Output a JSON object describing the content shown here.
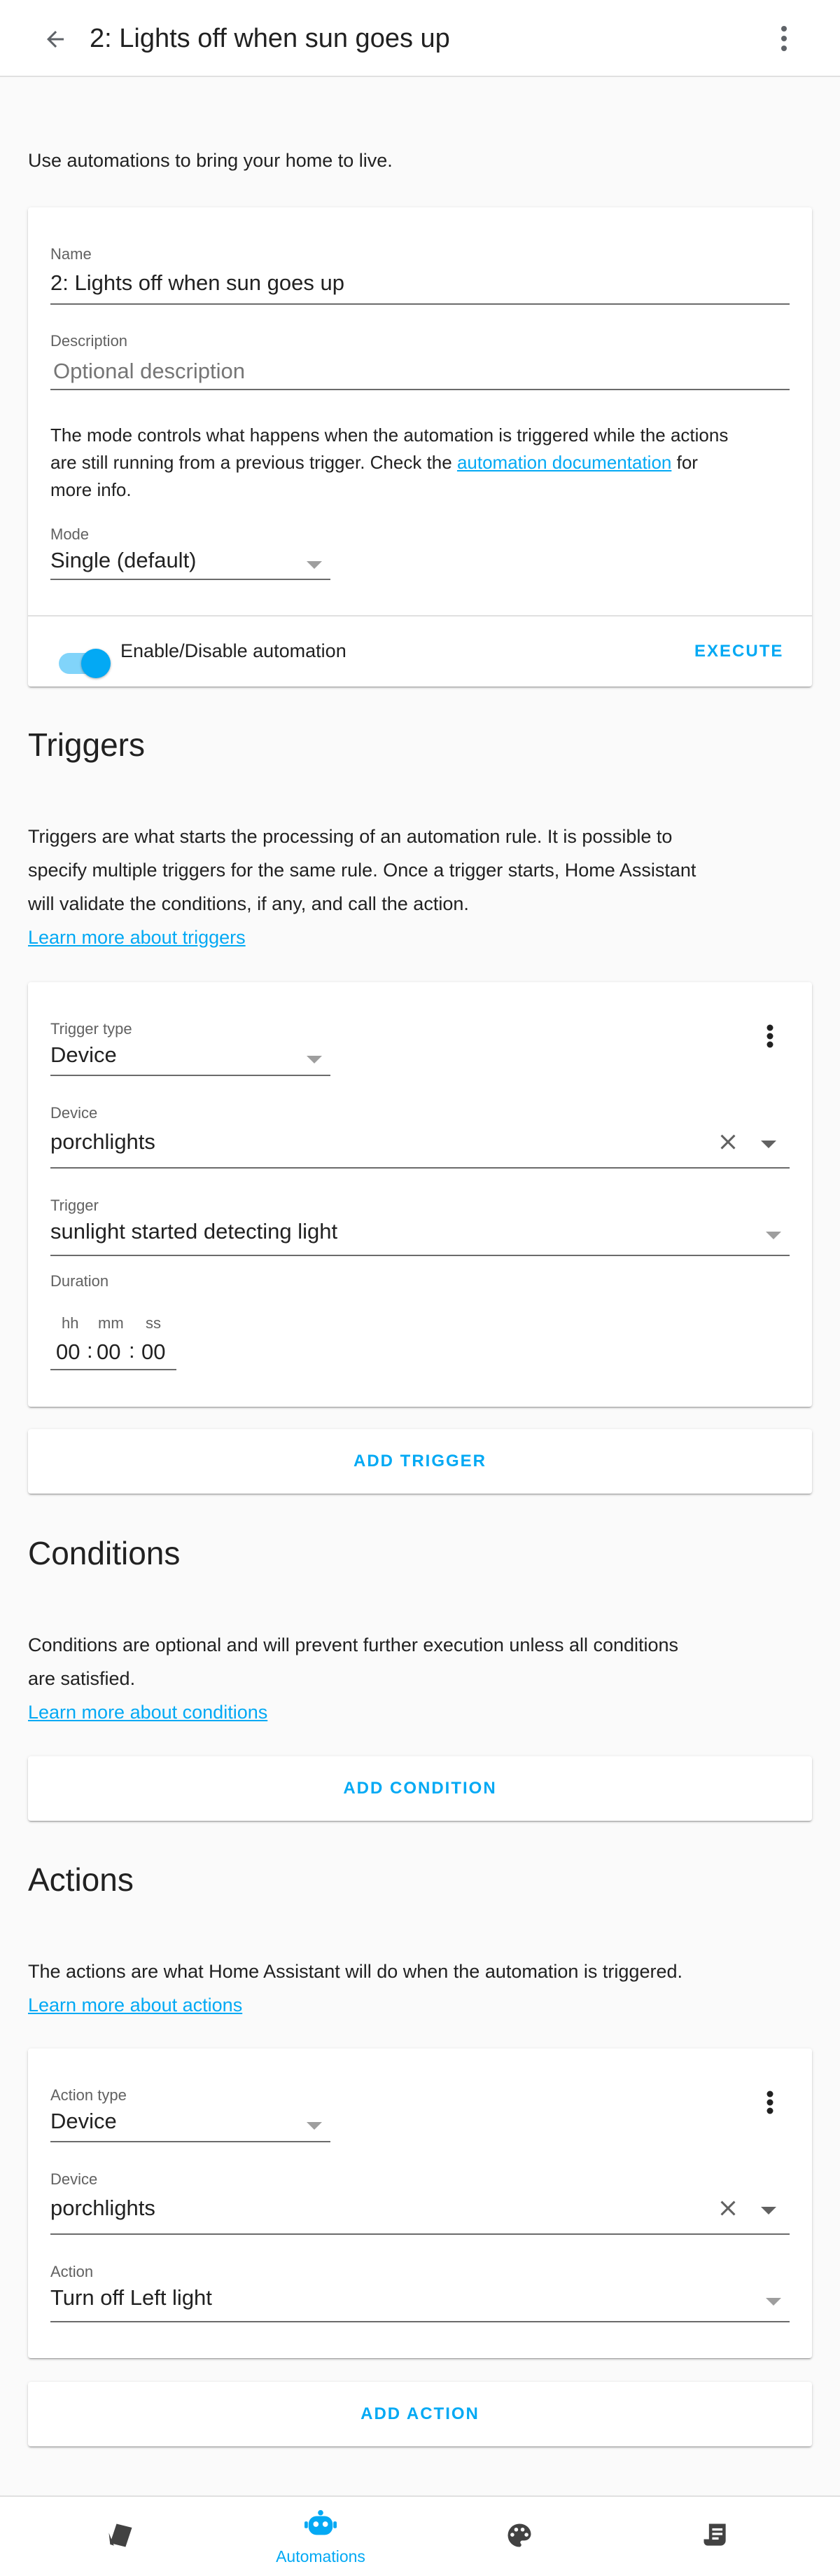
{
  "header": {
    "title": "2: Lights off when sun goes up"
  },
  "intro": "Use automations to bring your home to live.",
  "details": {
    "name_label": "Name",
    "name_value": "2: Lights off when sun goes up",
    "description_label": "Description",
    "description_placeholder": "Optional description",
    "mode_text_1": "The mode controls what happens when the automation is triggered while the actions",
    "mode_text_2": "are still running from a previous trigger. Check the ",
    "mode_link": "automation documentation",
    "mode_text_3": " for",
    "mode_text_4": "more info.",
    "mode_label": "Mode",
    "mode_value": "Single (default)",
    "toggle_label": "Enable/Disable automation",
    "toggle_on": true,
    "execute_label": "EXECUTE"
  },
  "triggers": {
    "title": "Triggers",
    "desc_1": "Triggers are what starts the processing of an automation rule. It is possible to",
    "desc_2": "specify multiple triggers for the same rule. Once a trigger starts, Home Assistant",
    "desc_3": "will validate the conditions, if any, and call the action.",
    "learn_more": "Learn more about triggers",
    "type_label": "Trigger type",
    "type_value": "Device",
    "device_label": "Device",
    "device_value": "porchlights",
    "trigger_label": "Trigger",
    "trigger_value": "sunlight started detecting light",
    "duration_label": "Duration",
    "hh_label": "hh",
    "mm_label": "mm",
    "ss_label": "ss",
    "hh_value": "00",
    "mm_value": "00",
    "ss_value": "00",
    "colon": ":",
    "add_label": "ADD TRIGGER"
  },
  "conditions": {
    "title": "Conditions",
    "desc_1": "Conditions are optional and will prevent further execution unless all conditions",
    "desc_2": "are satisfied.",
    "learn_more": "Learn more about conditions",
    "add_label": "ADD CONDITION"
  },
  "actions": {
    "title": "Actions",
    "desc_1": "The actions are what Home Assistant will do when the automation is triggered.",
    "learn_more": "Learn more about actions",
    "type_label": "Action type",
    "type_value": "Device",
    "device_label": "Device",
    "device_value": "porchlights",
    "action_label": "Action",
    "action_value": "Turn off Left light",
    "add_label": "ADD ACTION"
  },
  "bottom_nav": {
    "items": [
      {
        "icon": "sheet-icon",
        "label": ""
      },
      {
        "icon": "robot-icon",
        "label": "Automations",
        "active": true
      },
      {
        "icon": "palette-icon",
        "label": ""
      },
      {
        "icon": "script-icon",
        "label": ""
      }
    ]
  },
  "colors": {
    "accent": "#03a9f4",
    "text": "#212121",
    "secondary_text": "#616161",
    "background": "#fafafa"
  }
}
